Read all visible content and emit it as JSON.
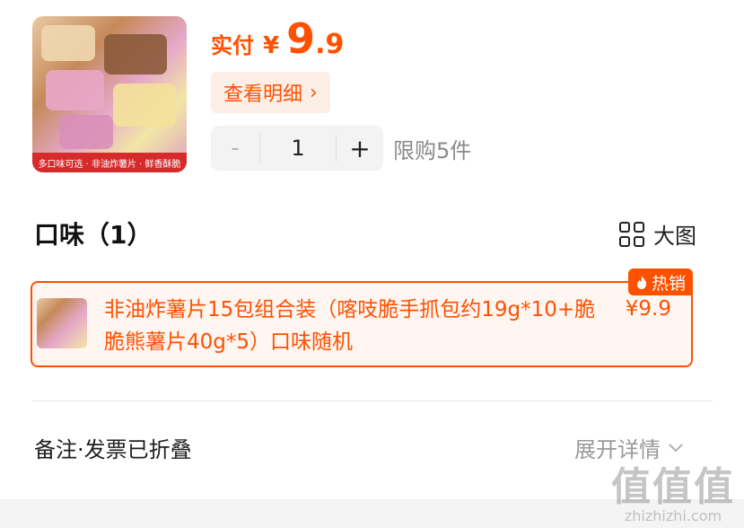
{
  "product": {
    "thumbnail_caption": "多口味可选 · 非油炸薯片 · 鲜香酥脆"
  },
  "price": {
    "label": "实付",
    "currency": "¥",
    "integer": "9",
    "dot": ".",
    "decimal": "9"
  },
  "detail_button": {
    "label": "查看明细",
    "chevron": "›"
  },
  "quantity": {
    "minus": "-",
    "value": "1",
    "plus": "+",
    "limit": "限购5件"
  },
  "flavor_section": {
    "title": "口味（1）",
    "view_label": "大图"
  },
  "option": {
    "name": "非油炸薯片15包组合装（喀吱脆手抓包约19g*10+脆脆熊薯片40g*5）口味随机",
    "price": "¥9.9",
    "badge": "热销",
    "badge_icon": "flame-icon"
  },
  "remark": {
    "label": "备注·发票已折叠",
    "expand_label": "展开详情",
    "expand_icon": "chevron-down-icon"
  },
  "watermark": {
    "logo": "值值值",
    "site": "zhizhizhi.com"
  },
  "colors": {
    "accent": "#ff5000",
    "accent_bg": "#fdeee6",
    "selected_bg": "#fff6f1"
  }
}
